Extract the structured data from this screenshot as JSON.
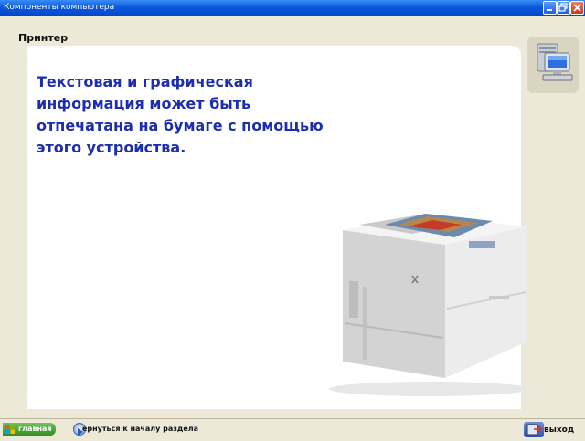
{
  "window": {
    "title": "Компоненты компьютера"
  },
  "page": {
    "heading": "Принтер",
    "description": "Текстовая и графическая информация может быть отпечатана на бумаге с помощью этого устройства."
  },
  "icons": {
    "minimize": "minimize-icon",
    "restore": "restore-icon",
    "close": "close-icon",
    "computer": "computer-icon",
    "printer": "printer-image",
    "windows_logo": "windows-logo-icon",
    "back": "back-arrow-icon",
    "exit": "exit-icon"
  },
  "footer": {
    "home_label": "главная",
    "back_label": "ернуться к началу раздела",
    "exit_label": "выход"
  },
  "colors": {
    "title_bar": "#0a58de",
    "text_accent": "#1c2dae",
    "home_button": "#2f8e22",
    "background": "#ece9d8"
  }
}
